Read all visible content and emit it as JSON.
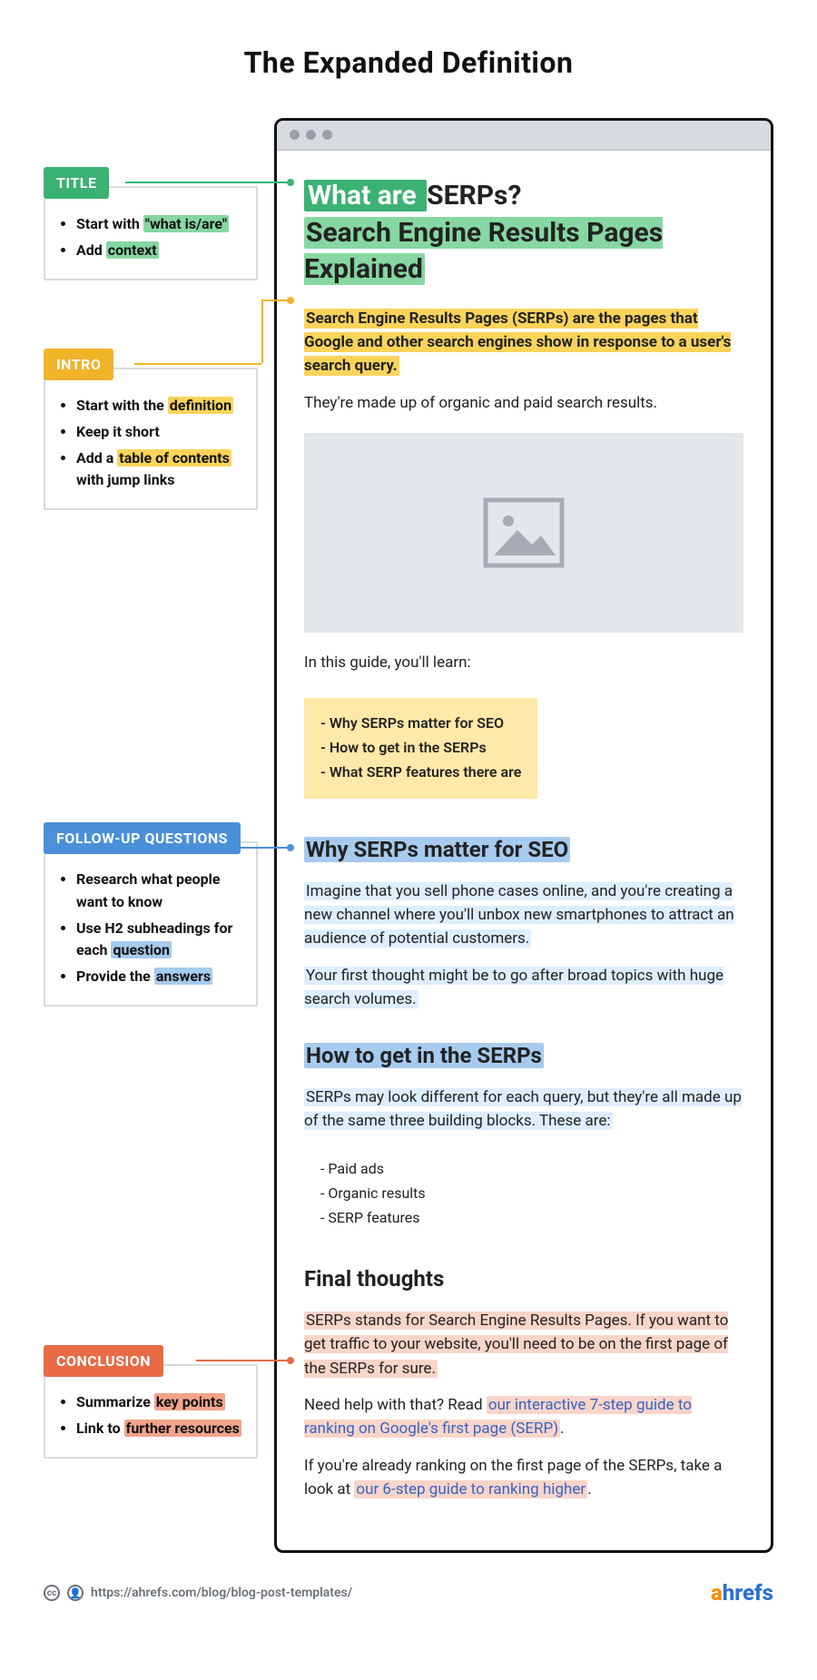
{
  "title": "The Expanded Definition",
  "annotations": {
    "title": {
      "label": "TITLE",
      "items": [
        {
          "pre": "Start with ",
          "hl": "\"what is/are\""
        },
        {
          "pre": "Add ",
          "hl": "context"
        }
      ]
    },
    "intro": {
      "label": "INTRO",
      "items": [
        {
          "pre": "Start with the ",
          "hl": "definition"
        },
        {
          "pre": "Keep it short",
          "hl": ""
        },
        {
          "pre": "Add a ",
          "hl": "table of contents",
          "post": " with jump links"
        }
      ]
    },
    "followup": {
      "label": "FOLLOW-UP QUESTIONS",
      "items": [
        {
          "pre": "Research what people want to know",
          "hl": ""
        },
        {
          "pre": "Use H2 subheadings for each ",
          "hl": "question"
        },
        {
          "pre": "Provide the ",
          "hl": "answers"
        }
      ]
    },
    "conclusion": {
      "label": "CONCLUSION",
      "items": [
        {
          "pre": "Summarize ",
          "hl": "key points"
        },
        {
          "pre": "Link to ",
          "hl": "further resources"
        }
      ]
    }
  },
  "article": {
    "h1_a": "What are ",
    "h1_b": "SERPs? ",
    "h1_c": "Search Engine Results Pages Explained",
    "intro": "Search Engine Results Pages (SERPs) are the pages that Google and other search engines show in response to a user's search query.",
    "intro_follow": "They're made up of organic and paid search results.",
    "learn_lead": "In this guide, you'll learn:",
    "toc": [
      "Why SERPs matter for SEO",
      "How to get in the SERPs",
      "What SERP features there are"
    ],
    "h2_1": "Why SERPs matter for SEO",
    "p1": "Imagine that you sell phone cases online, and you're creating a new channel where you'll unbox new smartphones to attract an audience of potential customers.",
    "p2": "Your first thought might be to go after broad topics with huge search volumes.",
    "h2_2": "How to get in the SERPs",
    "p3": "SERPs may look different for each query, but they're all made up of the same three building blocks. These are:",
    "bullets": [
      "Paid ads",
      "Organic results",
      "SERP features"
    ],
    "h2_3": "Final thoughts",
    "c1": "SERPs stands for Search Engine Results Pages. If you want to get traffic to your website, you'll need to be on the first page of the SERPs for sure.",
    "c2_pre": "Need help with that? Read ",
    "c2_link": "our interactive 7-step guide to ranking on Google's first page (SERP)",
    "c2_post": ".",
    "c3_pre": "If you're already ranking on the first page of the SERPs, take a look at ",
    "c3_link": "our 6-step guide to ranking higher",
    "c3_post": "."
  },
  "footer": {
    "url": "https://ahrefs.com/blog/blog-post-templates/",
    "brand_a": "ahrefs"
  },
  "colors": {
    "green": "#3bb273",
    "yellow": "#f0b429",
    "blue": "#4a90d9",
    "coral": "#e86a47"
  }
}
